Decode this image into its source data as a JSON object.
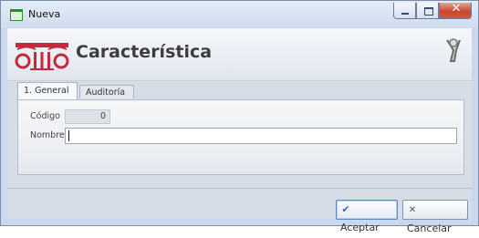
{
  "window": {
    "title": "Nueva"
  },
  "header": {
    "title": "Característica"
  },
  "tabs": [
    {
      "label": "1. General",
      "active": true
    },
    {
      "label": "Auditoría",
      "active": false
    }
  ],
  "form": {
    "code_label": "Código",
    "code_value": "0",
    "name_label": "Nombre",
    "name_value": ""
  },
  "footer": {
    "accept_label": "Aceptar",
    "cancel_label": "Cancelar"
  },
  "colors": {
    "logo_red": "#c8283c",
    "accent_blue": "#2d6cbf"
  },
  "icons": {
    "window": "window-icon",
    "logo": "temple-logo-icon",
    "tools": "tools-icon",
    "accept": "check-icon",
    "cancel": "close-icon"
  }
}
